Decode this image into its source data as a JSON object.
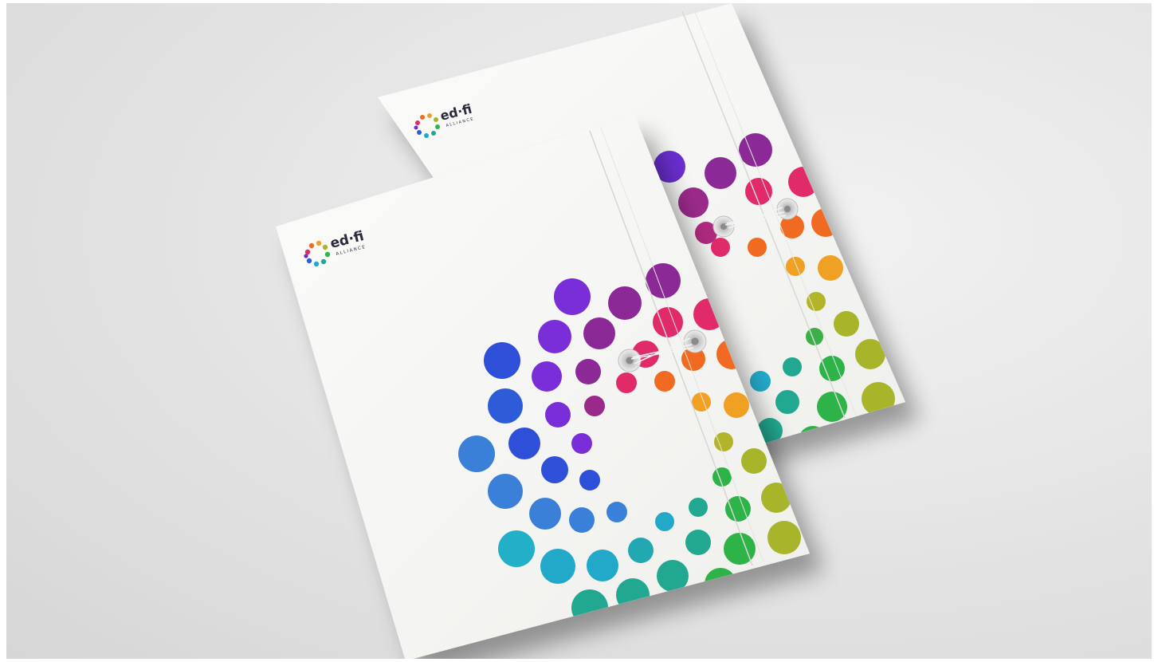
{
  "brand": {
    "wordmark": "ed·fi",
    "subline": "ALLIANCE"
  },
  "colors": {
    "backdrop": "#e4e4e4",
    "paper": "#f6f6f4",
    "accent_purple": "#7a2e9c",
    "accent_magenta": "#e0306e",
    "accent_orange": "#f08a24",
    "accent_green": "#2db34a",
    "accent_teal": "#20a8b0",
    "accent_blue": "#2f5bd8"
  },
  "folders": [
    {
      "id": "back-folder"
    },
    {
      "id": "front-folder"
    }
  ]
}
